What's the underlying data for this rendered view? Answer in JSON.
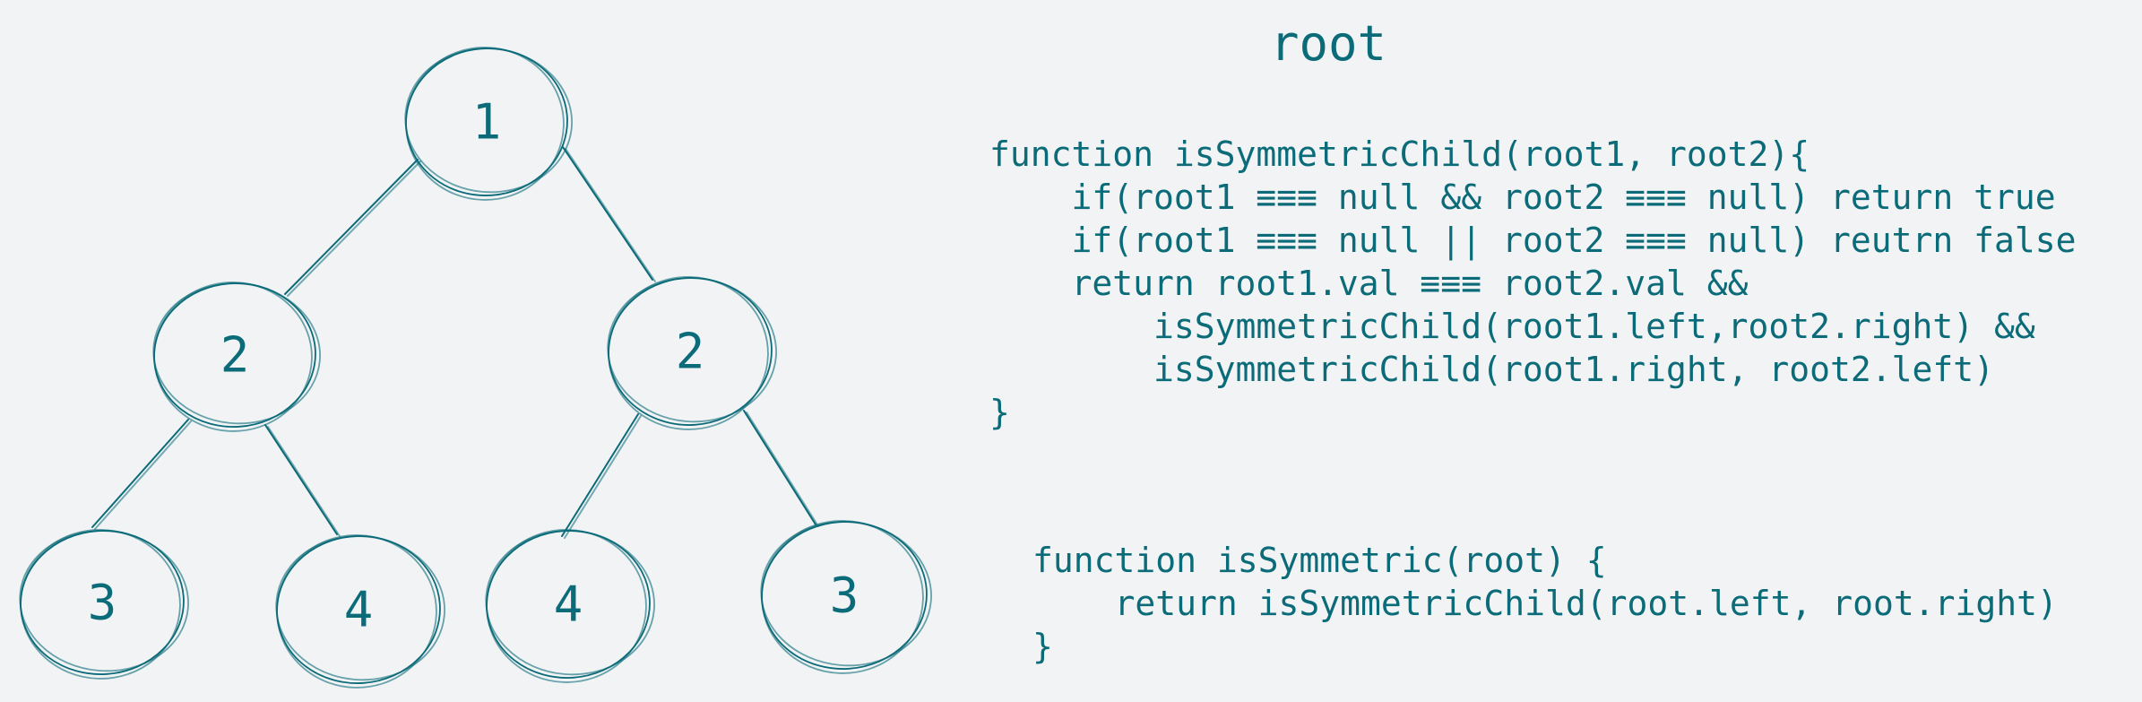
{
  "title": "root",
  "tree": {
    "nodes": [
      {
        "id": "n1",
        "label": "1"
      },
      {
        "id": "n2l",
        "label": "2"
      },
      {
        "id": "n2r",
        "label": "2"
      },
      {
        "id": "n3l",
        "label": "3"
      },
      {
        "id": "n4l",
        "label": "4"
      },
      {
        "id": "n4r",
        "label": "4"
      },
      {
        "id": "n3r",
        "label": "3"
      }
    ],
    "edges": [
      [
        "n1",
        "n2l"
      ],
      [
        "n1",
        "n2r"
      ],
      [
        "n2l",
        "n3l"
      ],
      [
        "n2l",
        "n4l"
      ],
      [
        "n2r",
        "n4r"
      ],
      [
        "n2r",
        "n3r"
      ]
    ]
  },
  "code": {
    "helper": [
      "function isSymmetricChild(root1, root2){",
      "    if(root1 ≡≡≡ null && root2 ≡≡≡ null) return true",
      "    if(root1 ≡≡≡ null || root2 ≡≡≡ null) reutrn false",
      "    return root1.val ≡≡≡ root2.val &&",
      "        isSymmetricChild(root1.left,root2.right) &&",
      "        isSymmetricChild(root1.right, root2.left)",
      "}"
    ],
    "main": [
      "function isSymmetric(root) {",
      "    return isSymmetricChild(root.left, root.right)",
      "}"
    ]
  },
  "colors": {
    "ink": "#0b6b78",
    "background": "#f1f3f5"
  }
}
